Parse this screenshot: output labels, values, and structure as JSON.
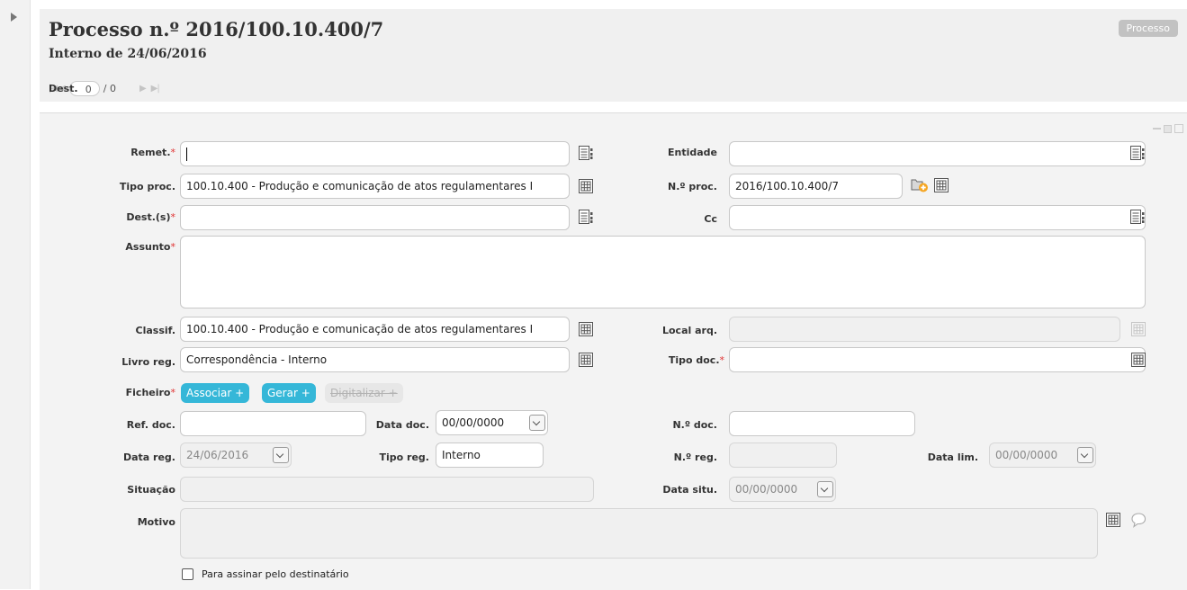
{
  "header": {
    "title": "Processo n.º 2016/100.10.400/7",
    "subtitle": "Interno de 24/06/2016",
    "badge": "Processo",
    "dest_label": "Dest.",
    "dest_current": "0",
    "dest_total": "/ 0"
  },
  "form": {
    "remet_label": "Remet.",
    "entidade_label": "Entidade",
    "tipo_proc_label": "Tipo proc.",
    "tipo_proc_value": "100.10.400 - Produção e comunicação de atos regulamentares I",
    "n_proc_label": "N.º proc.",
    "n_proc_value": "2016/100.10.400/7",
    "dest_label": "Dest.(s)",
    "cc_label": "Cc",
    "assunto_label": "Assunto",
    "classif_label": "Classif.",
    "classif_value": "100.10.400 - Produção e comunicação de atos regulamentares I",
    "local_arq_label": "Local arq.",
    "livro_reg_label": "Livro reg.",
    "livro_reg_value": "Correspondência - Interno",
    "tipo_doc_label": "Tipo doc.",
    "ficheiro_label": "Ficheiro",
    "associar": "Associar +",
    "gerar": "Gerar +",
    "digitalizar": "Digitalizar +",
    "ref_doc_label": "Ref. doc.",
    "data_doc_label": "Data doc.",
    "data_doc_value": "00/00/0000",
    "n_doc_label": "N.º doc.",
    "data_reg_label": "Data reg.",
    "data_reg_value": "24/06/2016",
    "tipo_reg_label": "Tipo reg.",
    "tipo_reg_value": "Interno",
    "n_reg_label": "N.º reg.",
    "data_lim_label": "Data lim.",
    "data_lim_value": "00/00/0000",
    "situacao_label": "Situação",
    "data_situ_label": "Data situ.",
    "data_situ_value": "00/00/0000",
    "motivo_label": "Motivo",
    "checkbox_label": "Para assinar pelo destinatário",
    "required_mark": "*"
  },
  "colors": {
    "accent": "#35b7d8",
    "required": "#e03030",
    "add_icon": "#f5a623"
  },
  "icons": [
    "expand-arrow-icon",
    "list-select-icon",
    "grid-picker-icon",
    "folder-add-icon",
    "comment-icon",
    "minimize-icon",
    "restore-icon",
    "maximize-icon"
  ]
}
